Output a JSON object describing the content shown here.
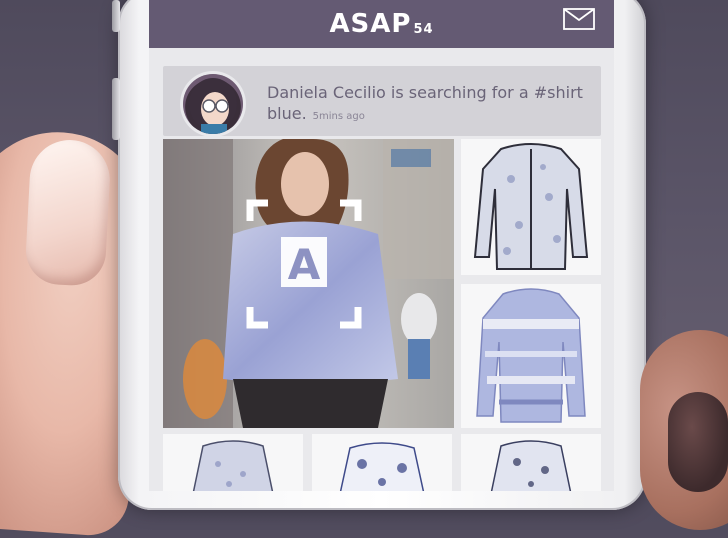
{
  "app_bar": {
    "logo_main": "ASAP",
    "logo_sub": "54",
    "icon": "mail-icon"
  },
  "notification": {
    "avatar_icon": "avatar",
    "message": "Daniela Cecilio is searching for a #shirt blue.",
    "time": "5mins ago"
  },
  "feed": {
    "hero_badge": "A",
    "products": [
      {
        "name": "product-black-trim-shirt"
      },
      {
        "name": "product-blue-sheer-shirt"
      },
      {
        "name": "product-shirt-3"
      },
      {
        "name": "product-shirt-4"
      },
      {
        "name": "product-shirt-5"
      }
    ]
  },
  "colors": {
    "app_bar": "#645a73",
    "screen_bg": "#e9e9ec",
    "notification_bg": "#d3d2d7",
    "text": "#6a6478"
  }
}
